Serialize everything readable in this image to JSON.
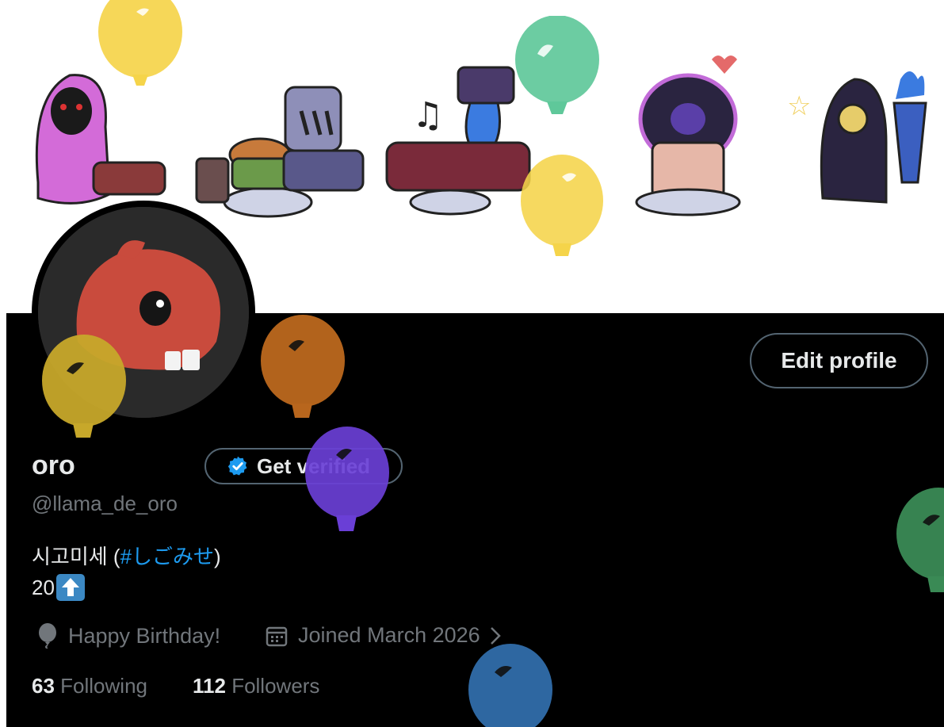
{
  "profile": {
    "name": "oro",
    "handle": "@llama_de_oro",
    "get_verified_label": "Get verified",
    "edit_profile_label": "Edit profile",
    "bio_line1_prefix": "시고미세 (",
    "bio_hashtag": "#しごみせ",
    "bio_line1_suffix": ")",
    "bio_line2": "20",
    "birthday_text": "Happy Birthday!",
    "joined_text": "Joined March 2026",
    "following_count": "63",
    "following_label": "Following",
    "followers_count": "112",
    "followers_label": "Followers"
  },
  "icons": {
    "verified": "verified-badge-icon",
    "balloon": "balloon-icon",
    "calendar": "calendar-icon",
    "chevron": "chevron-right-icon",
    "emoji": "up-arrow-emoji-icon"
  },
  "colors": {
    "background": "#000000",
    "text_primary": "#e7e9ea",
    "text_secondary": "#71767b",
    "link": "#1d9bf0",
    "border": "#536471",
    "balloon_yellow": "#f5d44a",
    "balloon_green": "#5fc89a",
    "balloon_orange": "#b8661d",
    "balloon_purple": "#6a3fd6",
    "balloon_blue": "#2f6aa6",
    "balloon_darkgreen": "#3a8a55"
  }
}
